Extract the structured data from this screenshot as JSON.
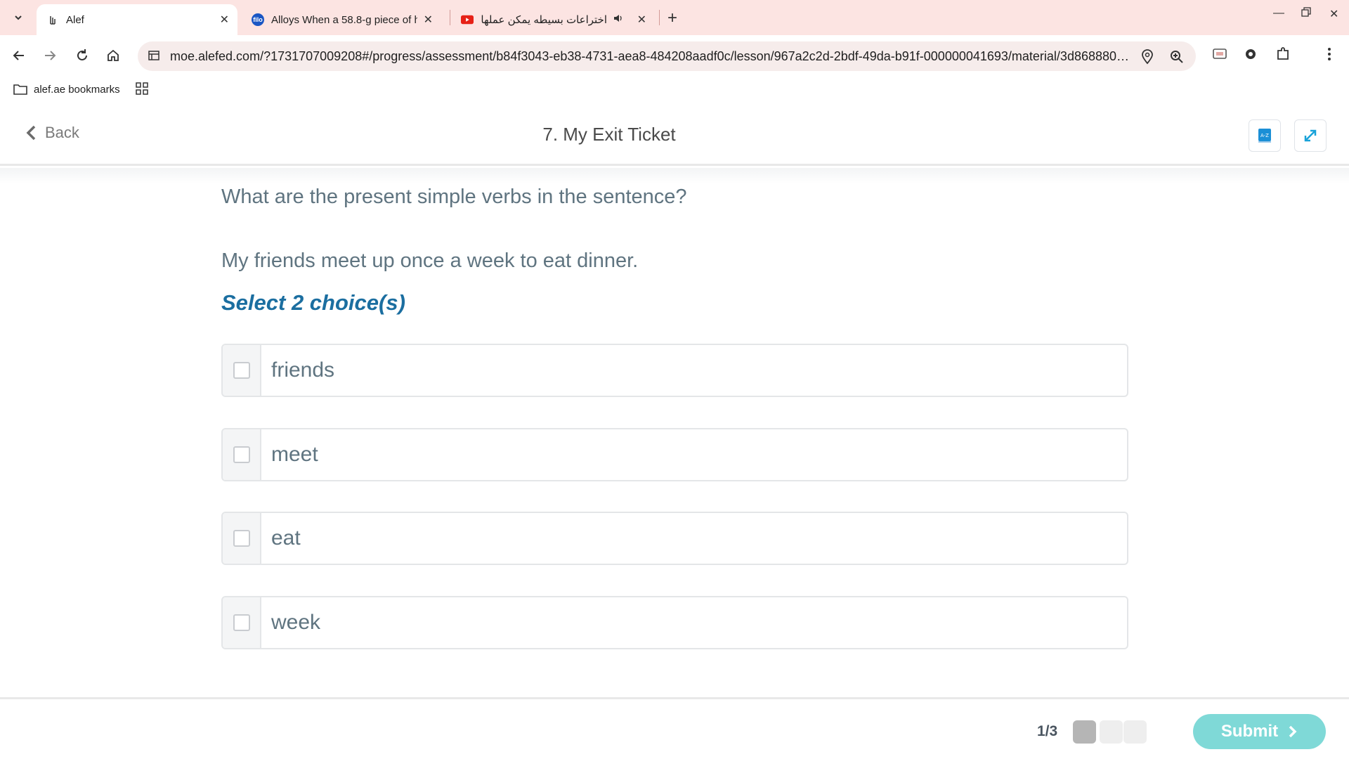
{
  "browser": {
    "tabs": [
      {
        "title": "Alef",
        "favicon": "alef-hand-icon",
        "active": true
      },
      {
        "title": "Alloys When a 58.8-g piece of h",
        "favicon": "filo-icon",
        "active": false
      },
      {
        "title": "اختراعات بسيطه يمكن عملها في",
        "favicon": "youtube-icon",
        "active": false
      }
    ],
    "filo_favicon_text": "filo",
    "url": "moe.alefed.com/?1731707009208#/progress/assessment/b84f3043-eb38-4731-aea8-484208aadf0c/lesson/967a2c2d-2bdf-49da-b91f-000000041693/material/3d868880-4...",
    "bookmark": "alef.ae bookmarks"
  },
  "header": {
    "back_label": "Back",
    "title": "7. My Exit Ticket",
    "az_label": "A-Z"
  },
  "question": {
    "prompt": "What are the present simple verbs in the sentence?",
    "sentence": "My friends meet up once a week to eat dinner.",
    "instruction": "Select 2 choice(s)",
    "choices": [
      {
        "label": "friends",
        "checked": false
      },
      {
        "label": "meet",
        "checked": false
      },
      {
        "label": "eat",
        "checked": false
      },
      {
        "label": "week",
        "checked": false
      }
    ]
  },
  "footer": {
    "progress": "1/3",
    "current_page": 1,
    "total_pages": 3,
    "submit_label": "Submit"
  },
  "colors": {
    "accent": "#1b6ea0",
    "submit": "#7fd9d7",
    "chrome_tab_strip": "#fce4e2"
  }
}
